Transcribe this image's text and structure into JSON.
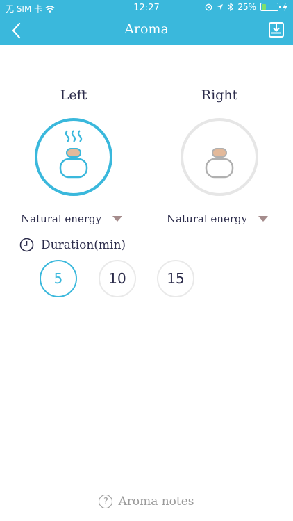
{
  "status_bar": {
    "carrier": "无 SIM 卡",
    "time": "12:27",
    "battery_percent": "25%",
    "battery_level": 0.25
  },
  "nav": {
    "title": "Aroma",
    "back_icon": "chevron-left-icon",
    "download_icon": "download-icon"
  },
  "sides": {
    "left": {
      "label": "Left",
      "scent": "Natural energy",
      "active": true
    },
    "right": {
      "label": "Right",
      "scent": "Natural energy",
      "active": false
    }
  },
  "duration": {
    "label": "Duration(min)",
    "options": [
      "5",
      "10",
      "15"
    ],
    "selected": "5"
  },
  "footer": {
    "notes_label": "Aroma notes",
    "help_glyph": "?"
  },
  "colors": {
    "accent": "#3ab8dc",
    "capsule": "#e3b99a",
    "inactive": "#b0b0b0"
  }
}
